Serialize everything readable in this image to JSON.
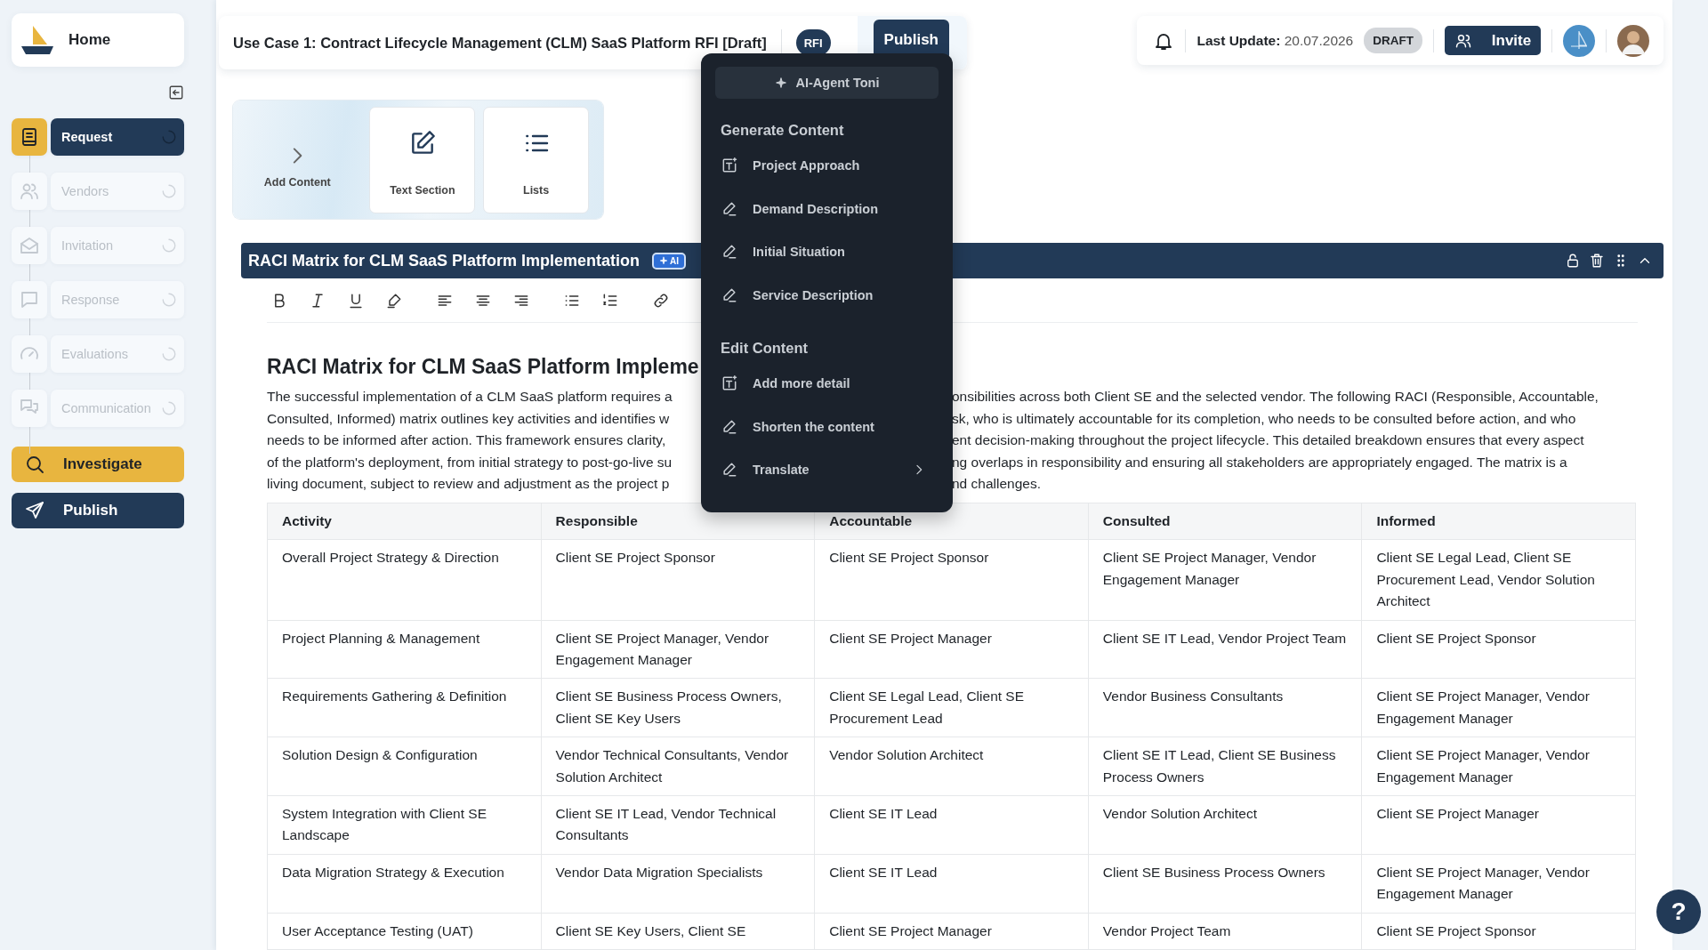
{
  "sidebar": {
    "home": "Home",
    "steps": [
      {
        "label": "Request",
        "selected": true
      },
      {
        "label": "Vendors",
        "selected": false
      },
      {
        "label": "Invitation",
        "selected": false
      },
      {
        "label": "Response",
        "selected": false
      },
      {
        "label": "Evaluations",
        "selected": false
      },
      {
        "label": "Communication",
        "selected": false
      }
    ],
    "actions": [
      {
        "label": "Investigate",
        "kind": "accent"
      },
      {
        "label": "Publish",
        "kind": "dark"
      }
    ]
  },
  "header": {
    "title": "Use Case 1: Contract Lifecycle Management (CLM) SaaS Platform RFI [Draft]",
    "type_badge": "RFI",
    "publish_button": "Publish",
    "last_update_label": "Last Update:",
    "last_update_date": "20.07.2026",
    "status_badge": "DRAFT",
    "invite_button": "Invite"
  },
  "add_content": {
    "label": "Add Content",
    "cards": [
      "Text Section",
      "Lists"
    ]
  },
  "section": {
    "title": "RACI Matrix for CLM SaaS Platform Implementation",
    "ai_badge": "AI",
    "heading": "RACI Matrix for CLM SaaS Platform Impleme",
    "paragraph_lines": [
      {
        "left": "The successful implementation of a CLM SaaS platform requires a",
        "right": "onsibilities across both Client SE and the selected vendor. The following RACI (Responsible, Accountable,"
      },
      {
        "left": "Consulted, Informed) matrix outlines key activities and identifies w",
        "right": "sk, who is ultimately accountable for its completion, who needs to be consulted before action, and who"
      },
      {
        "left": "needs to be informed after action. This framework ensures clarity,",
        "right": "ent decision-making throughout the project lifecycle. This detailed breakdown ensures that every aspect"
      },
      {
        "left": "of the platform's deployment, from initial strategy to post-go-live su",
        "right": "ng overlaps in responsibility and ensuring all stakeholders are appropriately engaged. The matrix is a"
      },
      {
        "left": "living document, subject to review and adjustment as the project p",
        "right": "nd challenges."
      }
    ],
    "table": {
      "columns": [
        "Activity",
        "Responsible",
        "Accountable",
        "Consulted",
        "Informed"
      ],
      "rows": [
        [
          "Overall Project Strategy & Direction",
          "Client SE Project Sponsor",
          "Client SE Project Sponsor",
          "Client SE Project Manager, Vendor Engagement Manager",
          "Client SE Legal Lead, Client SE Procurement Lead, Vendor Solution Architect"
        ],
        [
          "Project Planning & Management",
          "Client SE Project Manager, Vendor Engagement Manager",
          "Client SE Project Manager",
          "Client SE IT Lead, Vendor Project Team",
          "Client SE Project Sponsor"
        ],
        [
          "Requirements Gathering & Definition",
          "Client SE Business Process Owners, Client SE Key Users",
          "Client SE Legal Lead, Client SE Procurement Lead",
          "Vendor Business Consultants",
          "Client SE Project Manager, Vendor Engagement Manager"
        ],
        [
          "Solution Design & Configuration",
          "Vendor Technical Consultants, Vendor Solution Architect",
          "Vendor Solution Architect",
          "Client SE IT Lead, Client SE Business Process Owners",
          "Client SE Project Manager, Vendor Engagement Manager"
        ],
        [
          "System Integration with Client SE Landscape",
          "Client SE IT Lead, Vendor Technical Consultants",
          "Client SE IT Lead",
          "Vendor Solution Architect",
          "Client SE Project Manager"
        ],
        [
          "Data Migration Strategy & Execution",
          "Vendor Data Migration Specialists",
          "Client SE IT Lead",
          "Client SE Business Process Owners",
          "Client SE Project Manager, Vendor Engagement Manager"
        ],
        [
          "User Acceptance Testing (UAT)",
          "Client SE Key Users, Client SE",
          "Client SE Project Manager",
          "Vendor Project Team",
          "Client SE Project Sponsor"
        ]
      ]
    }
  },
  "ai_menu": {
    "agent_button": "AI-Agent Toni",
    "groups": [
      {
        "title": "Generate Content",
        "items": [
          {
            "label": "Project Approach",
            "kind": "compose",
            "submenu": false
          },
          {
            "label": "Demand Description",
            "kind": "edit",
            "submenu": false
          },
          {
            "label": "Initial Situation",
            "kind": "edit",
            "submenu": false
          },
          {
            "label": "Service Description",
            "kind": "edit",
            "submenu": false
          }
        ]
      },
      {
        "title": "Edit Content",
        "items": [
          {
            "label": "Add more detail",
            "kind": "compose",
            "submenu": false
          },
          {
            "label": "Shorten the content",
            "kind": "edit",
            "submenu": false
          },
          {
            "label": "Translate",
            "kind": "edit",
            "submenu": true
          }
        ]
      }
    ]
  },
  "help_button": "?"
}
